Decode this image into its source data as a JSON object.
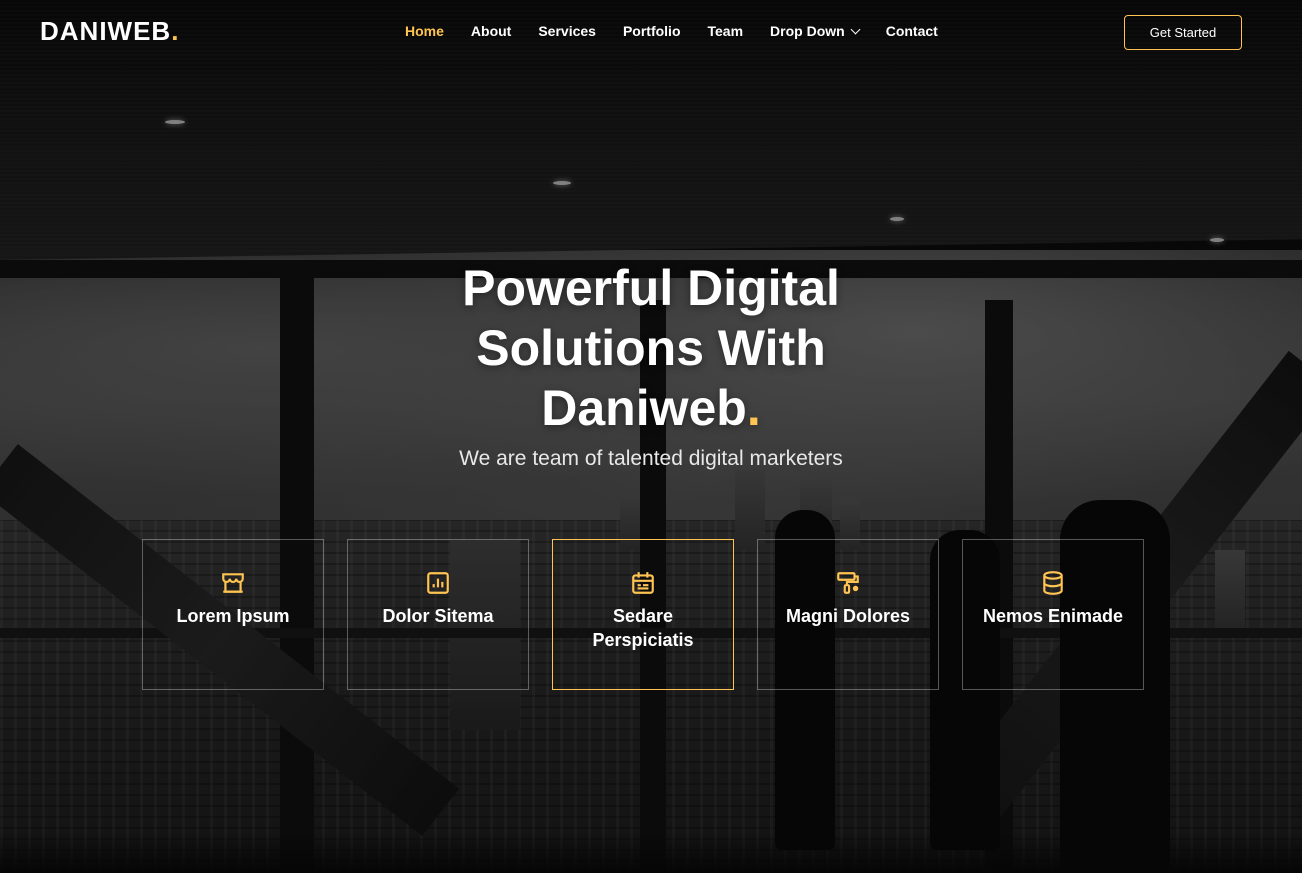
{
  "brand": {
    "name": "DANIWEB",
    "dot": ".",
    "accent_color": "#ffc451"
  },
  "nav": {
    "items": [
      {
        "label": "Home",
        "active": true
      },
      {
        "label": "About"
      },
      {
        "label": "Services"
      },
      {
        "label": "Portfolio"
      },
      {
        "label": "Team"
      },
      {
        "label": "Drop Down",
        "icon": "chevron-down-icon"
      },
      {
        "label": "Contact"
      }
    ]
  },
  "cta": {
    "label": "Get Started"
  },
  "hero": {
    "title_line1": "Powerful Digital",
    "title_line2": "Solutions With",
    "title_line3": "Daniweb",
    "title_dot": ".",
    "subtitle": "We are team of talented digital marketers"
  },
  "features": [
    {
      "label": "Lorem Ipsum",
      "icon": "store-icon"
    },
    {
      "label": "Dolor Sitema",
      "icon": "bar-chart-icon"
    },
    {
      "label": "Sedare Perspiciatis",
      "icon": "calendar-icon",
      "active": true
    },
    {
      "label": "Magni Dolores",
      "icon": "paint-roller-icon"
    },
    {
      "label": "Nemos Enimade",
      "icon": "database-icon"
    }
  ]
}
